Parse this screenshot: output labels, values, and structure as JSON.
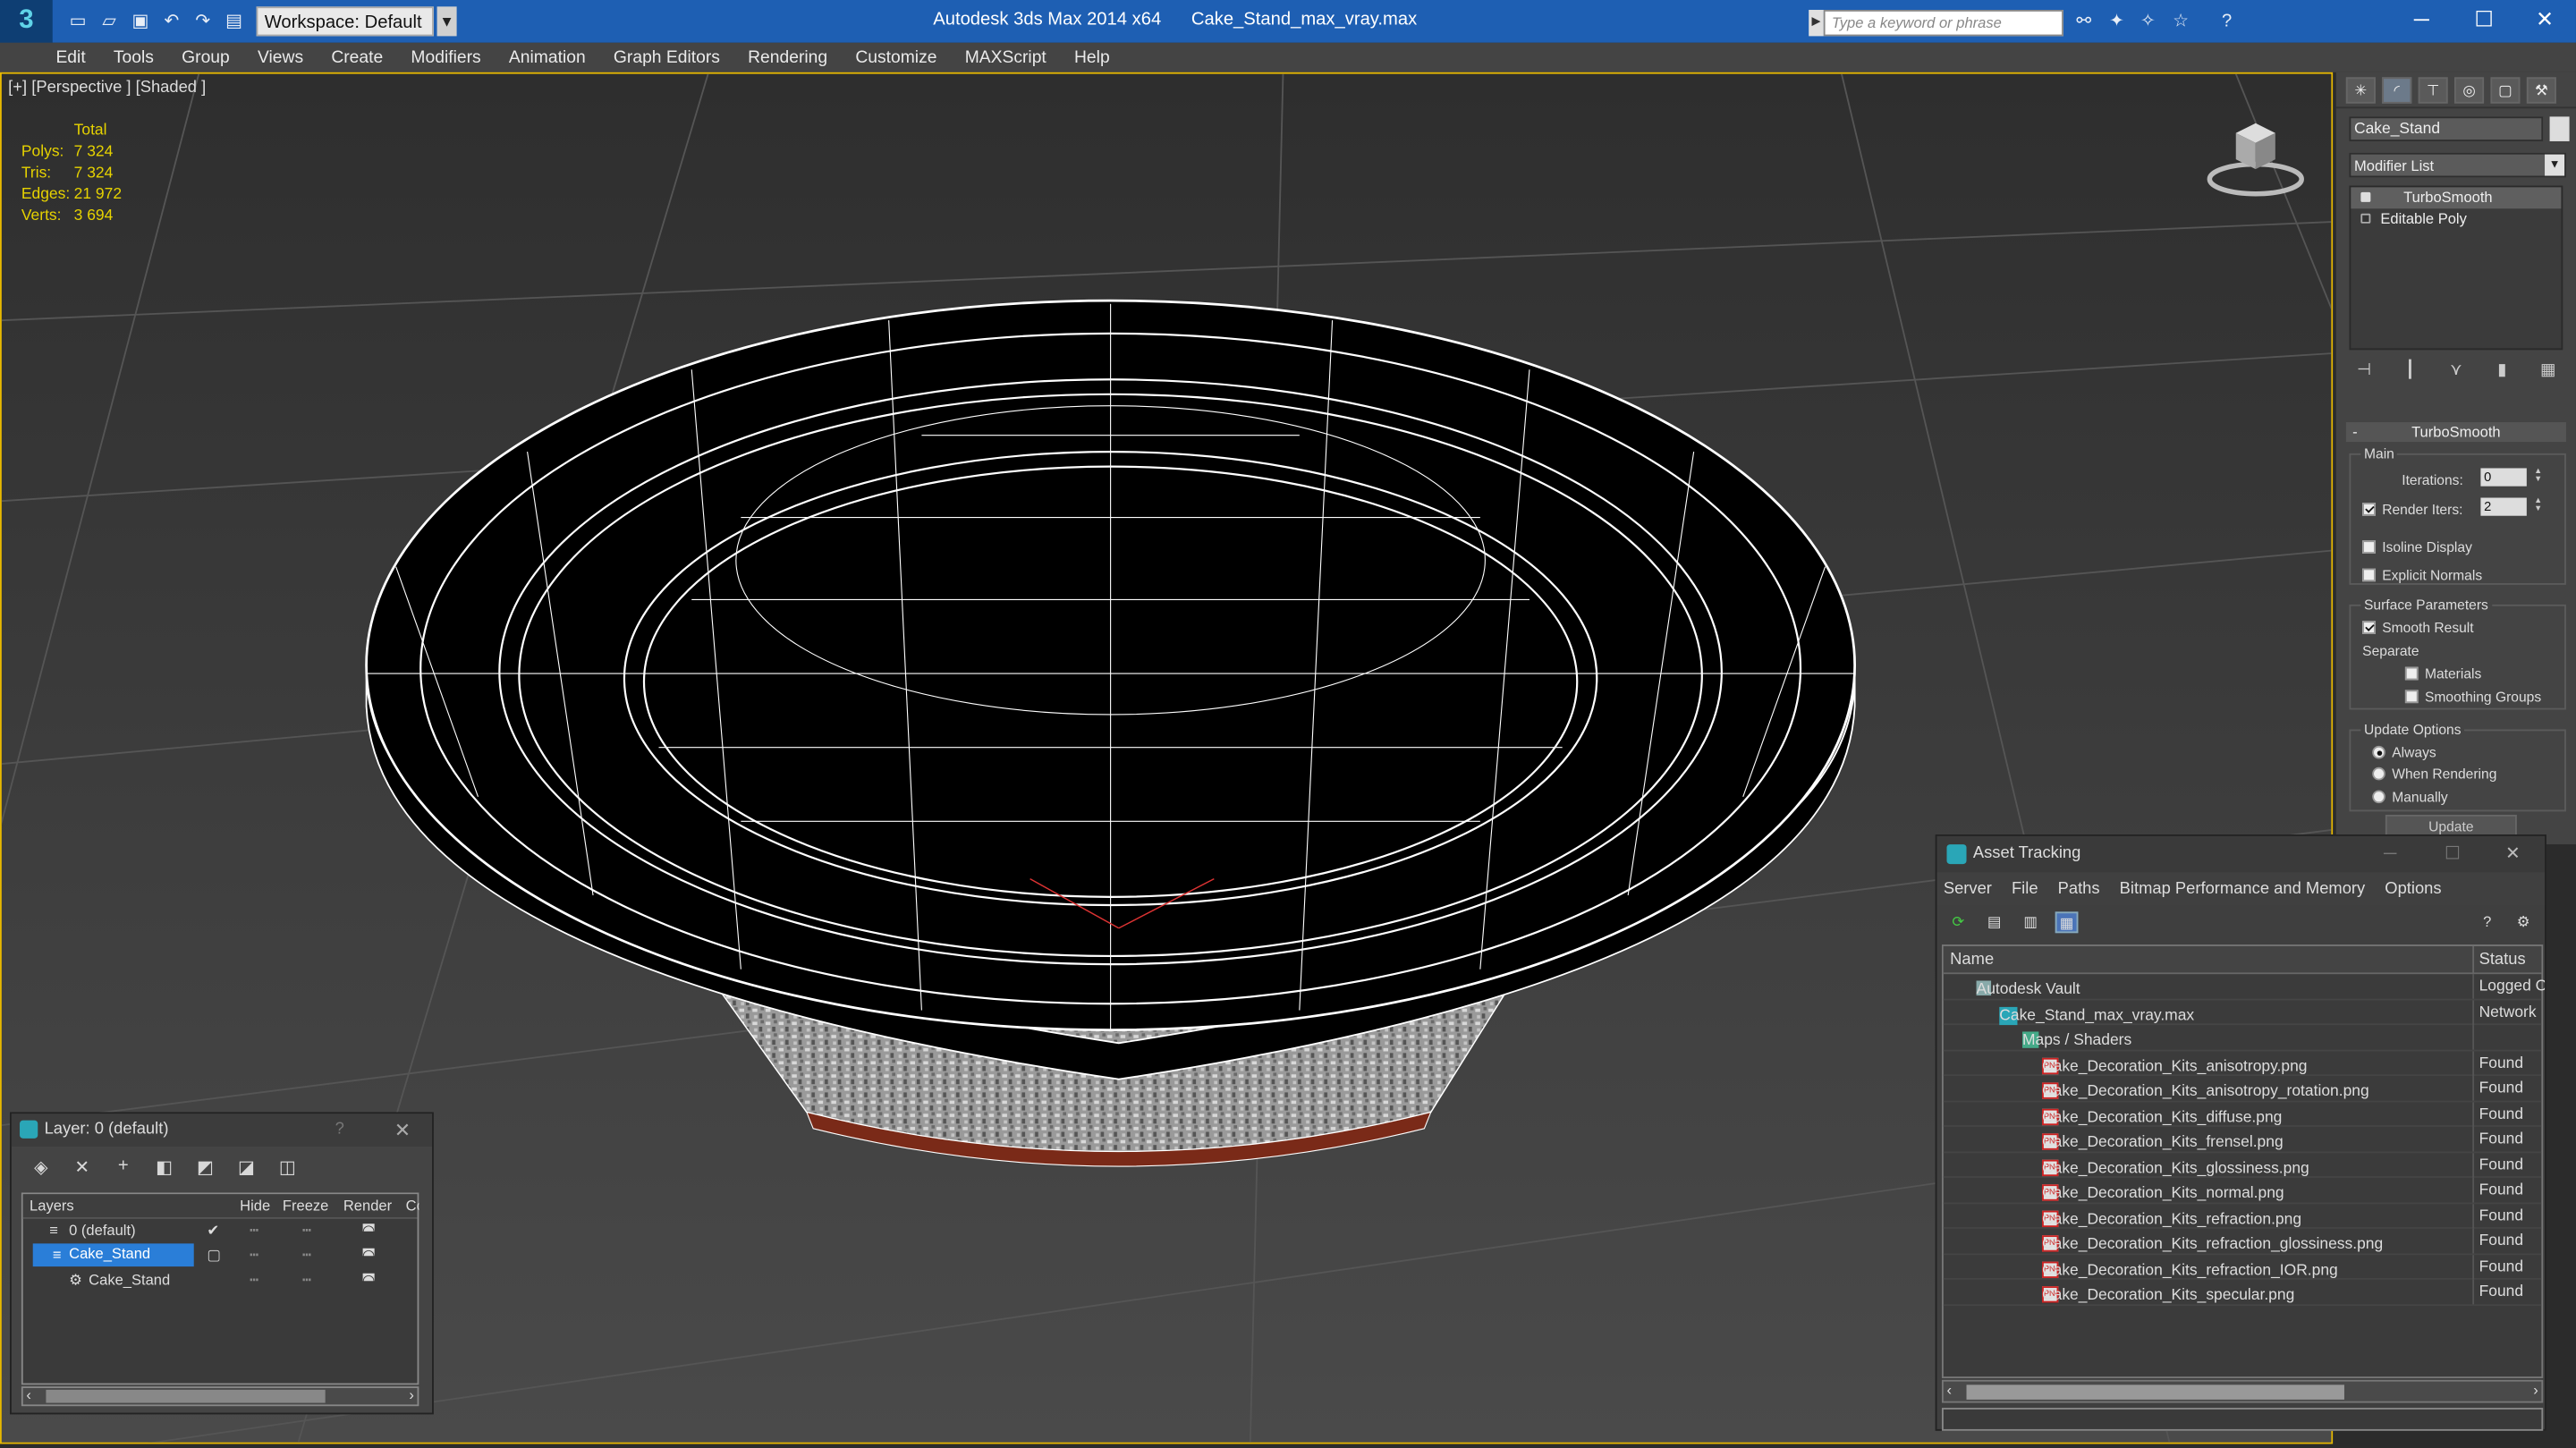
{
  "titlebar": {
    "app_title": "Autodesk 3ds Max  2014 x64",
    "file_title": "Cake_Stand_max_vray.max",
    "workspace": "Workspace: Default",
    "search_placeholder": "Type a keyword or phrase"
  },
  "menu": [
    "Edit",
    "Tools",
    "Group",
    "Views",
    "Create",
    "Modifiers",
    "Animation",
    "Graph Editors",
    "Rendering",
    "Customize",
    "MAXScript",
    "Help"
  ],
  "viewport": {
    "label": "[+] [Perspective ] [Shaded ]",
    "stats": {
      "header": "Total",
      "rows": [
        {
          "k": "Polys:",
          "v": "7 324"
        },
        {
          "k": "Tris:",
          "v": "7 324"
        },
        {
          "k": "Edges:",
          "v": "21 972"
        },
        {
          "k": "Verts:",
          "v": "3 694"
        }
      ]
    }
  },
  "command_panel": {
    "object_name": "Cake_Stand",
    "modifier_list": "Modifier List",
    "stack": [
      "TurboSmooth",
      "Editable Poly"
    ],
    "rollout_title": "TurboSmooth",
    "main_group": "Main",
    "iterations_label": "Iterations:",
    "iterations_value": "0",
    "render_iters_label": "Render Iters:",
    "render_iters_value": "2",
    "isoline": "Isoline Display",
    "explicit_normals": "Explicit Normals",
    "surface_group": "Surface Parameters",
    "smooth_result": "Smooth Result",
    "separate": "Separate",
    "materials": "Materials",
    "smoothing_groups": "Smoothing Groups",
    "update_group": "Update Options",
    "always": "Always",
    "when_rendering": "When Rendering",
    "manually": "Manually",
    "update_button": "Update"
  },
  "layer_dialog": {
    "title": "Layer: 0 (default)",
    "help": "?",
    "columns": [
      "Layers",
      "Hide",
      "Freeze",
      "Render",
      "Co"
    ],
    "rows": [
      {
        "name": "0 (default)"
      },
      {
        "name": "Cake_Stand"
      },
      {
        "name": "Cake_Stand"
      }
    ]
  },
  "asset_tracking": {
    "title": "Asset Tracking",
    "menu": [
      "Server",
      "File",
      "Paths",
      "Bitmap Performance and Memory",
      "Options"
    ],
    "columns": [
      "Name",
      "Status"
    ],
    "rows": [
      {
        "name": "Autodesk Vault",
        "status": "Logged O"
      },
      {
        "name": "Cake_Stand_max_vray.max",
        "status": "Network"
      },
      {
        "name": "Maps / Shaders",
        "status": ""
      },
      {
        "name": "Cake_Decoration_Kits_anisotropy.png",
        "status": "Found"
      },
      {
        "name": "Cake_Decoration_Kits_anisotropy_rotation.png",
        "status": "Found"
      },
      {
        "name": "Cake_Decoration_Kits_diffuse.png",
        "status": "Found"
      },
      {
        "name": "Cake_Decoration_Kits_frensel.png",
        "status": "Found"
      },
      {
        "name": "Cake_Decoration_Kits_glossiness.png",
        "status": "Found"
      },
      {
        "name": "Cake_Decoration_Kits_normal.png",
        "status": "Found"
      },
      {
        "name": "Cake_Decoration_Kits_refraction.png",
        "status": "Found"
      },
      {
        "name": "Cake_Decoration_Kits_refraction_glossiness.png",
        "status": "Found"
      },
      {
        "name": "Cake_Decoration_Kits_refraction_IOR.png",
        "status": "Found"
      },
      {
        "name": "Cake_Decoration_Kits_specular.png",
        "status": "Found"
      }
    ]
  },
  "colors": {
    "titlebar": "#1e5fb3",
    "viewport_border": "#e7b800",
    "stats_text": "#e6d200",
    "selection": "#2a7ed8"
  }
}
